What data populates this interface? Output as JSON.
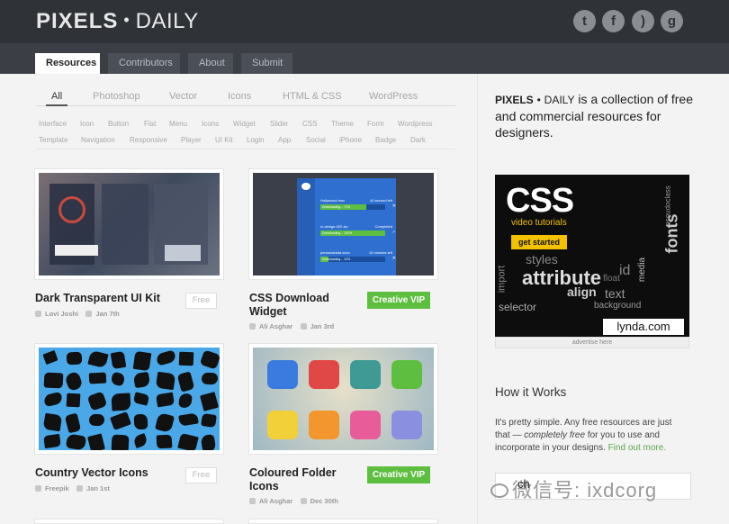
{
  "header": {
    "logo_bold": "PIXELS",
    "logo_dot": "•",
    "logo_light": "DAILY",
    "social": [
      {
        "name": "twitter-icon",
        "glyph": "t"
      },
      {
        "name": "facebook-icon",
        "glyph": "f"
      },
      {
        "name": "rss-icon",
        "glyph": ")"
      },
      {
        "name": "googleplus-icon",
        "glyph": "g"
      }
    ]
  },
  "nav": {
    "tabs": [
      "Resources",
      "Contributors",
      "About",
      "Submit"
    ],
    "active": "Resources"
  },
  "filters": [
    "All",
    "Photoshop",
    "Vector",
    "Icons",
    "HTML & CSS",
    "WordPress"
  ],
  "tags_row1": [
    "Interface",
    "Icon",
    "Button",
    "Flat",
    "Menu",
    "Icons",
    "Widget",
    "Slider",
    "CSS",
    "Theme",
    "Form",
    "Wordpress"
  ],
  "tags_row2": [
    "Template",
    "Navigation",
    "Responsive",
    "Player",
    "UI Kit",
    "Login",
    "App",
    "Social",
    "iPhone",
    "Badge",
    "Dark"
  ],
  "cards": [
    {
      "title": "Dark Transparent UI Kit",
      "author": "Lovi Joshi",
      "date": "Jan 7th",
      "badge": "Free"
    },
    {
      "title": "CSS Download Widget",
      "author": "Ali Asghar",
      "date": "Jan 3rd",
      "badge": "Creative VIP"
    },
    {
      "title": "Country Vector Icons",
      "author": "Freepik",
      "date": "Jan 1st",
      "badge": "Free"
    },
    {
      "title": "Coloured Folder Icons",
      "author": "Ali Asghar",
      "date": "Dec 30th",
      "badge": "Creative VIP"
    }
  ],
  "widget": {
    "rows": [
      {
        "file": "Hollywood.mov",
        "status": "40 second left",
        "bar": "Downloading... 71%",
        "progress": 0.71,
        "action": "✕"
      },
      {
        "file": "ui-design-002.zip",
        "status": "Completed",
        "bar": "Downloading... 100%",
        "progress": 1.0,
        "action": "✓"
      },
      {
        "file": "personaldata.docx",
        "status": "15 minutes left",
        "bar": "Downloading... 12%",
        "progress": 0.12,
        "action": "✕"
      }
    ]
  },
  "sidebar": {
    "intro_brand_bold": "PIXELS",
    "intro_brand_dot": "•",
    "intro_brand_light": "DAILY",
    "intro_text": " is a collection of free and commercial resources for designers.",
    "ad": {
      "headline": "CSS",
      "sub": "video tutorials",
      "cta": "get started",
      "brand": "lynda.com",
      "words": [
        "styles",
        "attribute",
        "align",
        "text",
        "import",
        "selector",
        "float",
        "fonts",
        "pseudoclass",
        "media",
        "background",
        "id"
      ]
    },
    "ad_caption": "advertise here",
    "how_title": "How it Works",
    "how_text_1": "It's pretty simple. Any free resources are just that — ",
    "how_text_em": "completely free",
    "how_text_2": " for you to use and incorporate in your designs. ",
    "how_link": "Find out more.",
    "watermark": "微信号: ixdcorg",
    "search_partial": "ch"
  },
  "colors": {
    "topbar": "#2f3237",
    "navbar": "#3b3f45",
    "vip_green": "#5ebe3f",
    "link_green": "#5ea64d",
    "thumb_blue": "#4aa8e8"
  }
}
